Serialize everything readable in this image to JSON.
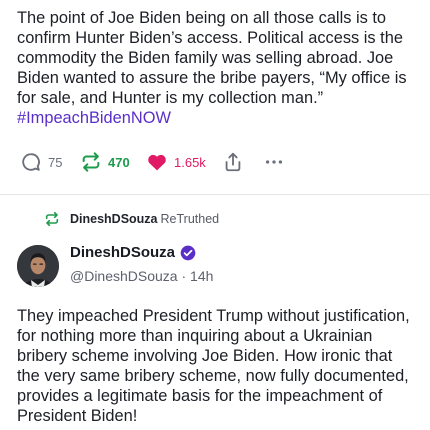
{
  "post": {
    "text": "The point of Joe Biden being on all those calls is to confirm Hunter Biden’s access. Political access is the commodity the Biden family was selling abroad. Joe Biden wanted to assure the bribe payers, “My office is for sale, and Hunter is my collection man.”",
    "hashtag": "#ImpeachBidenNOW"
  },
  "actions": {
    "reply_count": "75",
    "reply_icon": "reply-icon",
    "repost_count": "470",
    "repost_icon": "repost-icon",
    "like_count": "1.65k",
    "like_icon": "heart-icon",
    "share_icon": "share-icon",
    "more_icon": "more-icon"
  },
  "retruth": {
    "icon": "retruth-icon",
    "user": "DineshDSouza",
    "label": "ReTruthed"
  },
  "author": {
    "name": "DineshDSouza",
    "handle": "@DineshDSouza · 14h",
    "verified_icon": "verified-badge-icon"
  },
  "post2": {
    "text": "They impeached President Trump without justification, for nothing more than inquiring about a Ukrainian bribery scheme involving Joe Biden.  How ironic that the very same bribery scheme, now fully documented, provides a legitimate basis for the impeachment of President Biden!"
  },
  "colors": {
    "hashtag": "#5a2fc8",
    "repost_green": "#1e9b4c",
    "like_pink": "#e01a64",
    "verified_purple": "#5a2fc8"
  }
}
